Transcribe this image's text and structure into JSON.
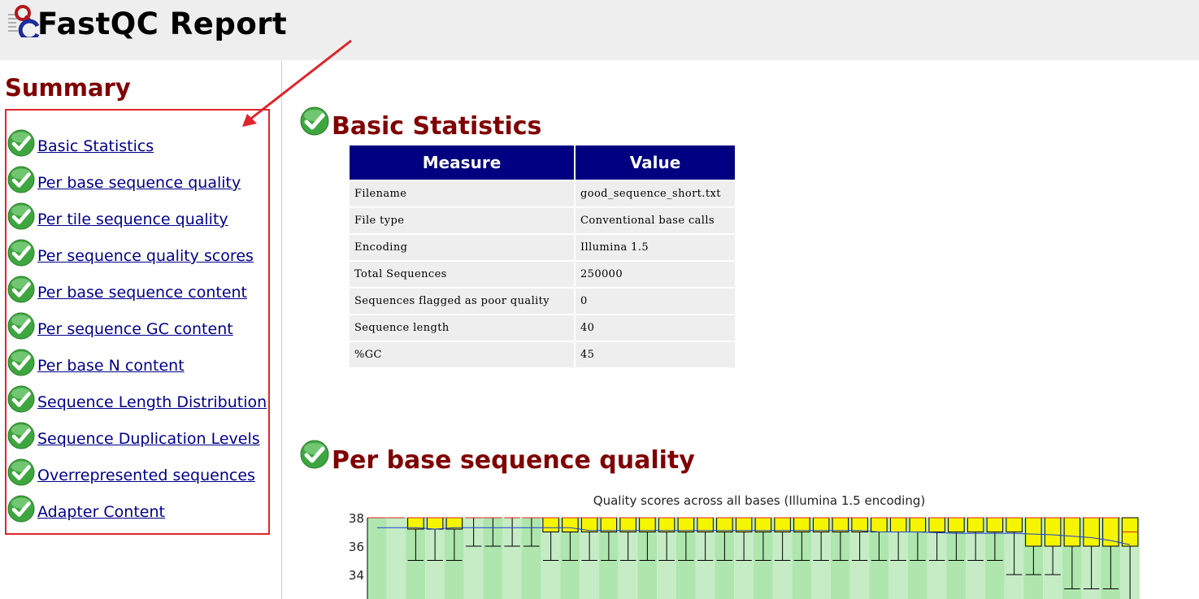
{
  "app": {
    "title": "FastQC Report"
  },
  "summary": {
    "title": "Summary",
    "items": [
      {
        "label": "Basic Statistics",
        "status": "pass"
      },
      {
        "label": "Per base sequence quality",
        "status": "pass"
      },
      {
        "label": "Per tile sequence quality",
        "status": "pass"
      },
      {
        "label": "Per sequence quality scores",
        "status": "pass"
      },
      {
        "label": "Per base sequence content",
        "status": "pass"
      },
      {
        "label": "Per sequence GC content",
        "status": "pass"
      },
      {
        "label": "Per base N content",
        "status": "pass"
      },
      {
        "label": "Sequence Length Distribution",
        "status": "pass"
      },
      {
        "label": "Sequence Duplication Levels",
        "status": "pass"
      },
      {
        "label": "Overrepresented sequences",
        "status": "pass"
      },
      {
        "label": "Adapter Content",
        "status": "pass"
      }
    ]
  },
  "basic_stats": {
    "title": "Basic Statistics",
    "headers": [
      "Measure",
      "Value"
    ],
    "rows": [
      [
        "Filename",
        "good_sequence_short.txt"
      ],
      [
        "File type",
        "Conventional base calls"
      ],
      [
        "Encoding",
        "Illumina 1.5"
      ],
      [
        "Total Sequences",
        "250000"
      ],
      [
        "Sequences flagged as poor quality",
        "0"
      ],
      [
        "Sequence length",
        "40"
      ],
      [
        "%GC",
        "45"
      ]
    ]
  },
  "per_base_quality": {
    "title": "Per base sequence quality"
  },
  "colors": {
    "section_title": "#800000",
    "link": "#00008b",
    "table_header": "#000080",
    "annotation": "#e0242c"
  },
  "chart_data": {
    "type": "box",
    "title": "Quality scores across all bases (Illumina 1.5 encoding)",
    "ytick_labels": [
      "38",
      "36",
      "34"
    ],
    "ylim": [
      32,
      38
    ],
    "positions": 40,
    "boxes": [
      {
        "q1": 38,
        "q3": 38,
        "lo": 38,
        "hi": 38,
        "median": 38,
        "mean": 37.3
      },
      {
        "q1": 38,
        "q3": 38,
        "lo": 38,
        "hi": 38,
        "median": 38,
        "mean": 37.3
      },
      {
        "q1": 37.2,
        "q3": 38,
        "lo": 35,
        "hi": 38,
        "median": 38,
        "mean": 37.3
      },
      {
        "q1": 37.2,
        "q3": 38,
        "lo": 35,
        "hi": 38,
        "median": 38,
        "mean": 37.2
      },
      {
        "q1": 37.2,
        "q3": 38,
        "lo": 35,
        "hi": 38,
        "median": 38,
        "mean": 37.3
      },
      {
        "q1": 38,
        "q3": 38,
        "lo": 36,
        "hi": 38,
        "median": 38,
        "mean": 37.3
      },
      {
        "q1": 38,
        "q3": 38,
        "lo": 36,
        "hi": 38,
        "median": 38,
        "mean": 37.3
      },
      {
        "q1": 38,
        "q3": 38,
        "lo": 36,
        "hi": 38,
        "median": 38,
        "mean": 37.3
      },
      {
        "q1": 38,
        "q3": 38,
        "lo": 36,
        "hi": 38,
        "median": 38,
        "mean": 37.3
      },
      {
        "q1": 37,
        "q3": 38,
        "lo": 35,
        "hi": 38,
        "median": 38,
        "mean": 37.3
      },
      {
        "q1": 37,
        "q3": 38,
        "lo": 35,
        "hi": 38,
        "median": 38,
        "mean": 37.3
      },
      {
        "q1": 37,
        "q3": 38,
        "lo": 35,
        "hi": 38,
        "median": 38,
        "mean": 37.1
      },
      {
        "q1": 37,
        "q3": 38,
        "lo": 35,
        "hi": 38,
        "median": 38,
        "mean": 37.1
      },
      {
        "q1": 37,
        "q3": 38,
        "lo": 35,
        "hi": 38,
        "median": 38,
        "mean": 37.1
      },
      {
        "q1": 37,
        "q3": 38,
        "lo": 35,
        "hi": 38,
        "median": 38,
        "mean": 37.1
      },
      {
        "q1": 37,
        "q3": 38,
        "lo": 35,
        "hi": 38,
        "median": 38,
        "mean": 37.1
      },
      {
        "q1": 37,
        "q3": 38,
        "lo": 35,
        "hi": 38,
        "median": 38,
        "mean": 37.1
      },
      {
        "q1": 37,
        "q3": 38,
        "lo": 35,
        "hi": 38,
        "median": 38,
        "mean": 37.1
      },
      {
        "q1": 37,
        "q3": 38,
        "lo": 35,
        "hi": 38,
        "median": 38,
        "mean": 37.1
      },
      {
        "q1": 37,
        "q3": 38,
        "lo": 35,
        "hi": 38,
        "median": 38,
        "mean": 37.1
      },
      {
        "q1": 37,
        "q3": 38,
        "lo": 35,
        "hi": 38,
        "median": 38,
        "mean": 37.1
      },
      {
        "q1": 37,
        "q3": 38,
        "lo": 35,
        "hi": 38,
        "median": 38,
        "mean": 37.1
      },
      {
        "q1": 37,
        "q3": 38,
        "lo": 35,
        "hi": 38,
        "median": 38,
        "mean": 37.1
      },
      {
        "q1": 37,
        "q3": 38,
        "lo": 35,
        "hi": 38,
        "median": 38,
        "mean": 37.1
      },
      {
        "q1": 37,
        "q3": 38,
        "lo": 35,
        "hi": 38,
        "median": 38,
        "mean": 37.1
      },
      {
        "q1": 37,
        "q3": 38,
        "lo": 35,
        "hi": 38,
        "median": 38,
        "mean": 37.1
      },
      {
        "q1": 37,
        "q3": 38,
        "lo": 35,
        "hi": 38,
        "median": 38,
        "mean": 37.0
      },
      {
        "q1": 37,
        "q3": 38,
        "lo": 35,
        "hi": 38,
        "median": 38,
        "mean": 37.0
      },
      {
        "q1": 37,
        "q3": 38,
        "lo": 35,
        "hi": 38,
        "median": 38,
        "mean": 37.0
      },
      {
        "q1": 37,
        "q3": 38,
        "lo": 35,
        "hi": 38,
        "median": 38,
        "mean": 36.95
      },
      {
        "q1": 37,
        "q3": 38,
        "lo": 35,
        "hi": 38,
        "median": 38,
        "mean": 36.9
      },
      {
        "q1": 37,
        "q3": 38,
        "lo": 35,
        "hi": 38,
        "median": 38,
        "mean": 36.9
      },
      {
        "q1": 37,
        "q3": 38,
        "lo": 35,
        "hi": 38,
        "median": 38,
        "mean": 36.9
      },
      {
        "q1": 37,
        "q3": 38,
        "lo": 34,
        "hi": 38,
        "median": 38,
        "mean": 36.9
      },
      {
        "q1": 36,
        "q3": 38,
        "lo": 34,
        "hi": 38,
        "median": 38,
        "mean": 36.85
      },
      {
        "q1": 36,
        "q3": 38,
        "lo": 34,
        "hi": 38,
        "median": 38,
        "mean": 36.8
      },
      {
        "q1": 36,
        "q3": 38,
        "lo": 33,
        "hi": 38,
        "median": 38,
        "mean": 36.7
      },
      {
        "q1": 36,
        "q3": 38,
        "lo": 33,
        "hi": 38,
        "median": 38,
        "mean": 36.6
      },
      {
        "q1": 36,
        "q3": 38,
        "lo": 33,
        "hi": 38,
        "median": 38,
        "mean": 36.4
      },
      {
        "q1": 36,
        "q3": 38,
        "lo": 32,
        "hi": 38,
        "median": 37,
        "mean": 36.1
      }
    ]
  }
}
